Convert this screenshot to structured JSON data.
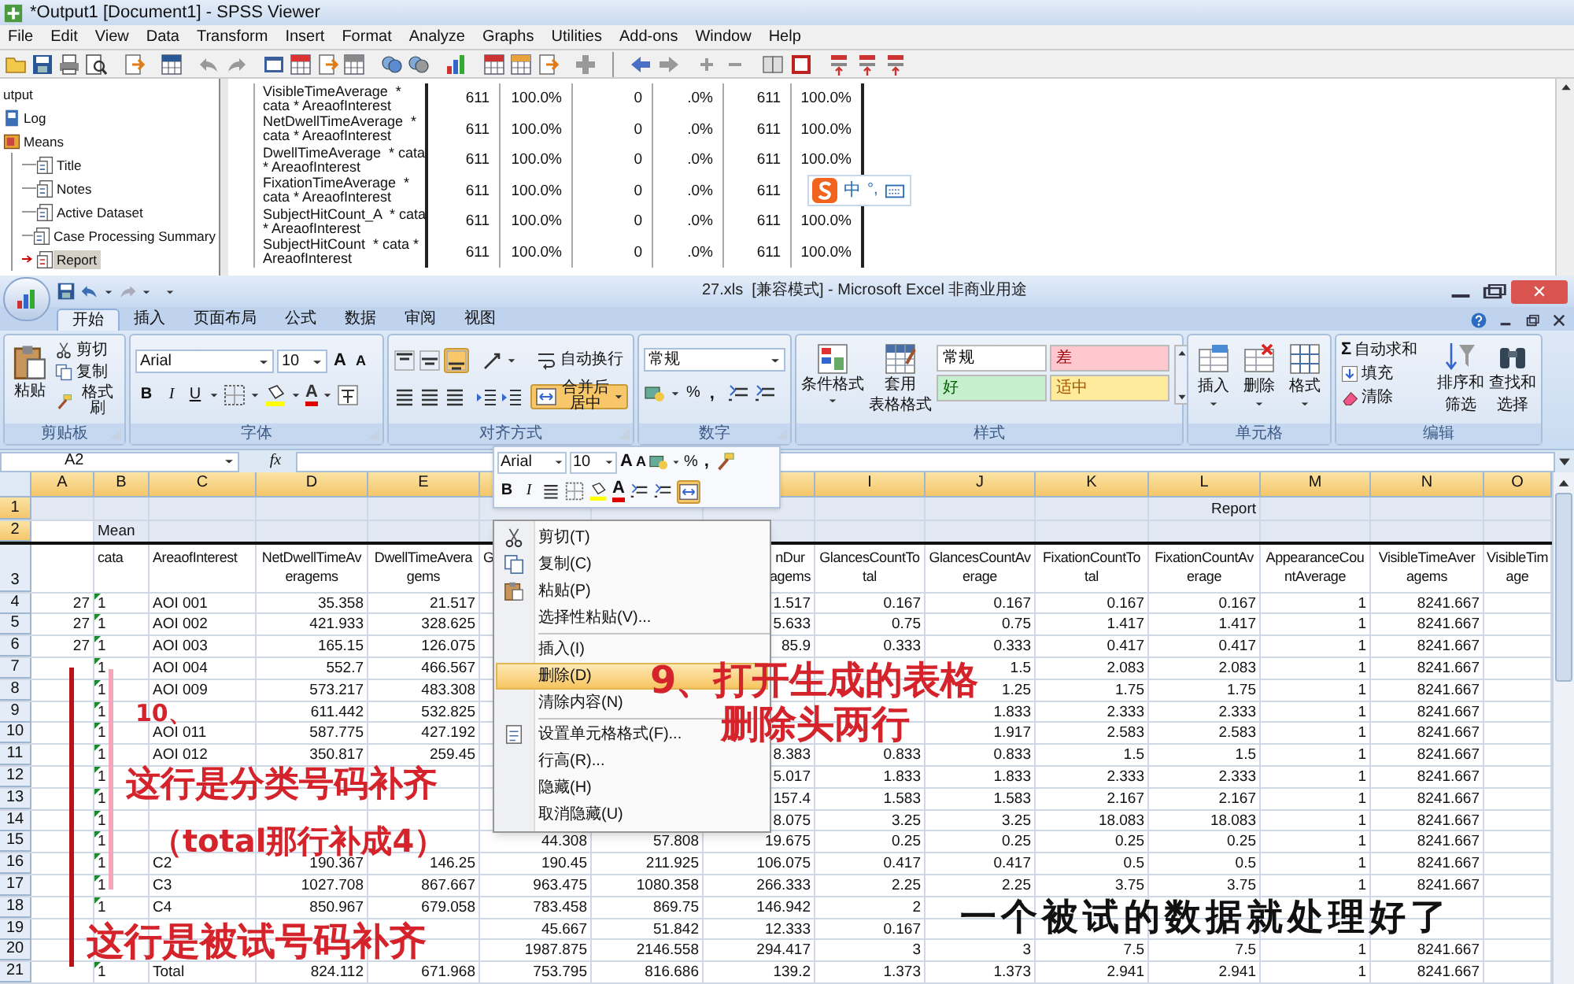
{
  "spss": {
    "title": "*Output1 [Document1] - SPSS Viewer",
    "menu": [
      "File",
      "Edit",
      "View",
      "Data",
      "Transform",
      "Insert",
      "Format",
      "Analyze",
      "Graphs",
      "Utilities",
      "Add-ons",
      "Window",
      "Help"
    ],
    "outline": [
      {
        "label": "utput",
        "selected": false,
        "children": [
          {
            "label": "Log",
            "selected": false
          },
          {
            "label": "Means",
            "selected": false,
            "children": [
              {
                "label": "Title",
                "selected": false
              },
              {
                "label": "Notes",
                "selected": false
              },
              {
                "label": "Active Dataset",
                "selected": false
              },
              {
                "label": "Case Processing Summary",
                "selected": false
              },
              {
                "label": "Report",
                "selected": true
              }
            ]
          }
        ]
      }
    ],
    "table_rows": [
      {
        "label": "VisibleTimeAverage  *\ncata * AreaofInterest",
        "cells": [
          "611",
          "100.0%",
          "0",
          ".0%",
          "611",
          "100.0%"
        ]
      },
      {
        "label": "NetDwellTimeAverage  *\ncata * AreaofInterest",
        "cells": [
          "611",
          "100.0%",
          "0",
          ".0%",
          "611",
          "100.0%"
        ]
      },
      {
        "label": "DwellTimeAverage  * cata\n* AreaofInterest",
        "cells": [
          "611",
          "100.0%",
          "0",
          ".0%",
          "611",
          "100.0%"
        ]
      },
      {
        "label": "FixationTimeAverage  *\ncata * AreaofInterest",
        "cells": [
          "611",
          "100.0%",
          "0",
          ".0%",
          "611"
        ]
      },
      {
        "label": "SubjectHitCount_A  * cata\n* AreaofInterest",
        "cells": [
          "611",
          "100.0%",
          "0",
          ".0%",
          "611",
          "100.0%"
        ]
      },
      {
        "label": "SubjectHitCount  * cata *\nAreaofInterest",
        "cells": [
          "611",
          "100.0%",
          "0",
          ".0%",
          "611",
          "100.0%"
        ]
      }
    ]
  },
  "ime_bar": {
    "mode": "中",
    "punctuation": "°,"
  },
  "excel": {
    "title": "27.xls  [兼容模式] - Microsoft Excel 非商业用途",
    "tabs": [
      {
        "label": "开始",
        "selected": true
      },
      {
        "label": "插入",
        "selected": false
      },
      {
        "label": "页面布局",
        "selected": false
      },
      {
        "label": "公式",
        "selected": false
      },
      {
        "label": "数据",
        "selected": false
      },
      {
        "label": "审阅",
        "selected": false
      },
      {
        "label": "视图",
        "selected": false
      }
    ],
    "clipboard": {
      "title": "剪贴板",
      "paste": "粘贴",
      "cut": "剪切",
      "copy": "复制",
      "format_painter": "格式刷"
    },
    "font": {
      "title": "字体",
      "name": "Arial",
      "size": "10",
      "grow": "A",
      "shrink": "A",
      "bold": "B",
      "italic": "I",
      "underline": "U",
      "color_letter": "A"
    },
    "alignment": {
      "title": "对齐方式",
      "wrap": "自动换行",
      "merge": "合并后居中",
      "merge_on": true,
      "bottom_align_on": true
    },
    "number": {
      "title": "数字",
      "format": "常规",
      "percent": "%",
      "comma": ","
    },
    "styles": {
      "title": "样式",
      "conditional": "条件格式",
      "table": [
        "套用",
        "表格格式"
      ],
      "cells": [
        {
          "label": "常规",
          "color": "#ffffff"
        },
        {
          "label": "差",
          "color": "#ffc7ce"
        },
        {
          "label": "好",
          "color": "#c6efce"
        },
        {
          "label": "适中",
          "color": "#ffeb9c"
        }
      ]
    },
    "cells": {
      "title": "单元格",
      "buttons": [
        "插入",
        "删除",
        "格式"
      ]
    },
    "editing": {
      "title": "编辑",
      "sigma": "Σ",
      "autosum": "自动求和",
      "fill": "填充",
      "clear": "清除",
      "sort": [
        "排序和",
        "筛选"
      ],
      "find": [
        "查找和",
        "选择"
      ]
    },
    "name_box": "A2",
    "fx": "fx",
    "columns": [
      "A",
      "B",
      "C",
      "D",
      "E",
      "I",
      "J",
      "K",
      "L",
      "M",
      "N",
      "O"
    ],
    "rows": [
      {
        "number": "1",
        "selected": true,
        "cells": {
          "L": "Report"
        }
      },
      {
        "number": "2",
        "selected": true,
        "cells": {
          "B": "Mean"
        }
      },
      {
        "number": "3",
        "selected": false,
        "cells": {
          "B": "cata",
          "C": "AreaofInterest",
          "D": "NetDwellTimeAv\neragems",
          "E": "DwellTimeAvera\ngems",
          "F": "G",
          "H": "nDur\nagems",
          "I": "GlancesCountTo\ntal",
          "J": "GlancesCountAv\nerage",
          "K": "FixationCountTo\ntal",
          "L": "FixationCountAv\nerage",
          "M": "AppearanceCou\nntAverage",
          "N": "VisibleTimeAver\nagems",
          "O": "VisibleTim\nage"
        }
      },
      {
        "number": "4",
        "selected": false,
        "cells": {
          "A": "27",
          "B": "1",
          "C": "AOI 001",
          "D": "35.358",
          "E": "21.517",
          "H": "1.517",
          "I": "0.167",
          "J": "0.167",
          "K": "0.167",
          "L": "0.167",
          "M": "1",
          "N": "8241.667"
        }
      },
      {
        "number": "5",
        "selected": false,
        "cells": {
          "A": "27",
          "B": "1",
          "C": "AOI 002",
          "D": "421.933",
          "E": "328.625",
          "H": "5.633",
          "I": "0.75",
          "J": "0.75",
          "K": "1.417",
          "L": "1.417",
          "M": "1",
          "N": "8241.667"
        }
      },
      {
        "number": "6",
        "selected": false,
        "cells": {
          "A": "27",
          "B": "1",
          "C": "AOI 003",
          "D": "165.15",
          "E": "126.075",
          "H": "85.9",
          "I": "0.333",
          "J": "0.333",
          "K": "0.417",
          "L": "0.417",
          "M": "1",
          "N": "8241.667"
        }
      },
      {
        "number": "7",
        "selected": false,
        "cells": {
          "B": "1",
          "C": "AOI 004",
          "D": "552.7",
          "E": "466.567",
          "J": "1.5",
          "K": "2.083",
          "L": "2.083",
          "M": "1",
          "N": "8241.667"
        }
      },
      {
        "number": "8",
        "selected": false,
        "cells": {
          "B": "1",
          "C": "AOI 009",
          "D": "573.217",
          "E": "483.308",
          "J": "1.25",
          "K": "1.75",
          "L": "1.75",
          "M": "1",
          "N": "8241.667"
        }
      },
      {
        "number": "9",
        "selected": false,
        "cells": {
          "B": "1",
          "D": "611.442",
          "E": "532.825",
          "J": "1.833",
          "K": "2.333",
          "L": "2.333",
          "M": "1",
          "N": "8241.667"
        }
      },
      {
        "number": "10",
        "selected": false,
        "cells": {
          "B": "1",
          "C": "AOI 011",
          "D": "587.775",
          "E": "427.192",
          "J": "1.917",
          "K": "2.583",
          "L": "2.583",
          "M": "1",
          "N": "8241.667"
        }
      },
      {
        "number": "11",
        "selected": false,
        "cells": {
          "B": "1",
          "C": "AOI 012",
          "D": "350.817",
          "E": "259.45",
          "H": "8.383",
          "I": "0.833",
          "J": "0.833",
          "K": "1.5",
          "L": "1.5",
          "M": "1",
          "N": "8241.667"
        }
      },
      {
        "number": "12",
        "selected": false,
        "cells": {
          "B": "1",
          "H": "5.017",
          "I": "1.833",
          "J": "1.833",
          "K": "2.333",
          "L": "2.333",
          "M": "1",
          "N": "8241.667"
        }
      },
      {
        "number": "13",
        "selected": false,
        "cells": {
          "B": "1",
          "H": "157.4",
          "I": "1.583",
          "J": "1.583",
          "K": "2.167",
          "L": "2.167",
          "M": "1",
          "N": "8241.667"
        }
      },
      {
        "number": "14",
        "selected": false,
        "cells": {
          "B": "1",
          "H": "8.075",
          "I": "3.25",
          "J": "3.25",
          "K": "18.083",
          "L": "18.083",
          "M": "1",
          "N": "8241.667"
        }
      },
      {
        "number": "15",
        "selected": false,
        "cells": {
          "B": "1",
          "F": "44.308",
          "G": "57.808",
          "H": "19.675",
          "I": "0.25",
          "J": "0.25",
          "K": "0.25",
          "L": "0.25",
          "M": "1",
          "N": "8241.667"
        }
      },
      {
        "number": "16",
        "selected": false,
        "cells": {
          "B": "1",
          "C": "C2",
          "D": "190.367",
          "E": "146.25",
          "F": "190.45",
          "G": "211.925",
          "H": "106.075",
          "I": "0.417",
          "J": "0.417",
          "K": "0.5",
          "L": "0.5",
          "M": "1",
          "N": "8241.667"
        }
      },
      {
        "number": "17",
        "selected": false,
        "cells": {
          "B": "1",
          "C": "C3",
          "D": "1027.708",
          "E": "867.667",
          "F": "963.475",
          "G": "1080.358",
          "H": "266.333",
          "I": "2.25",
          "J": "2.25",
          "K": "3.75",
          "L": "3.75",
          "M": "1",
          "N": "8241.667"
        }
      },
      {
        "number": "18",
        "selected": false,
        "cells": {
          "B": "1",
          "C": "C4",
          "D": "850.967",
          "E": "679.058",
          "F": "783.458",
          "G": "869.75",
          "H": "146.942",
          "I": "2"
        }
      },
      {
        "number": "19",
        "selected": false,
        "cells": {
          "F": "45.667",
          "G": "51.842",
          "H": "12.333",
          "I": "0.167"
        }
      },
      {
        "number": "20",
        "selected": false,
        "cells": {
          "F": "1987.875",
          "G": "2146.558",
          "H": "294.417",
          "I": "3",
          "J": "3",
          "K": "7.5",
          "L": "7.5",
          "M": "1",
          "N": "8241.667"
        }
      },
      {
        "number": "21",
        "selected": false,
        "cells": {
          "B": "1",
          "C": "Total",
          "D": "824.112",
          "E": "671.968",
          "F": "753.795",
          "G": "816.686",
          "H": "139.2",
          "I": "1.373",
          "J": "1.373",
          "K": "2.941",
          "L": "2.941",
          "M": "1",
          "N": "8241.667"
        }
      }
    ]
  },
  "mini_toolbar": {
    "font_name": "Arial",
    "font_size": "10",
    "grow": "A",
    "shrink": "A",
    "percent": "%",
    "comma": ",",
    "bold": "B",
    "italic": "I",
    "color_letter": "A",
    "merge_on": true
  },
  "context_menu": [
    {
      "label": "剪切(T)",
      "selected": false,
      "separator_before": false
    },
    {
      "label": "复制(C)",
      "selected": false,
      "separator_before": false
    },
    {
      "label": "粘贴(P)",
      "selected": false,
      "separator_before": false
    },
    {
      "label": "选择性粘贴(V)...",
      "selected": false,
      "separator_before": false
    },
    {
      "label": "插入(I)",
      "selected": false,
      "separator_before": true
    },
    {
      "label": "删除(D)",
      "selected": true,
      "separator_before": false
    },
    {
      "label": "清除内容(N)",
      "selected": false,
      "separator_before": false
    },
    {
      "label": "设置单元格格式(F)...",
      "selected": false,
      "separator_before": true
    },
    {
      "label": "行高(R)...",
      "selected": false,
      "separator_before": false
    },
    {
      "label": "隐藏(H)",
      "selected": false,
      "separator_before": false
    },
    {
      "label": "取消隐藏(U)",
      "selected": false,
      "separator_before": false
    }
  ],
  "annotations": [
    {
      "text": "9、打开生成的表格",
      "color": "#d4232b"
    },
    {
      "text": "删除头两行",
      "color": "#d4232b"
    },
    {
      "text": "10、",
      "color": "#d4232b"
    },
    {
      "text": "这行是分类号码补齐",
      "color": "#d4232b"
    },
    {
      "text": "（total那行补成4）",
      "color": "#d4232b"
    },
    {
      "text": "这行是被试号码补齐",
      "color": "#d4232b"
    },
    {
      "text": "一个被试的数据就处理好了",
      "color": "#111111"
    }
  ]
}
